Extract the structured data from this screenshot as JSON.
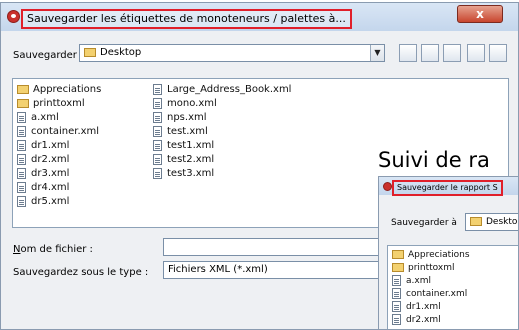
{
  "dialog": {
    "title": "Sauvegarder les étiquettes de monoteneurs / palettes à...",
    "close_label": "x",
    "save_in_label": "Sauvegarder à",
    "save_in_value": "Desktop",
    "files_col1": [
      "Appreciations",
      "printtoxml",
      "a.xml",
      "container.xml",
      "dr1.xml",
      "dr2.xml",
      "dr3.xml",
      "dr4.xml",
      "dr5.xml"
    ],
    "files_col2": [
      "Large_Address_Book.xml",
      "mono.xml",
      "nps.xml",
      "test.xml",
      "test1.xml",
      "test2.xml",
      "test3.xml"
    ],
    "filename_label": "Nom de fichier :",
    "filename_value": "",
    "filetype_label": "Sauvegardez sous le type :",
    "filetype_value": "Fichiers XML (*.xml)"
  },
  "overlay": {
    "heading": "Suivi de ra"
  },
  "dialog2": {
    "title": "Sauvegarder le rapport S",
    "save_in_label": "Sauvegarder à",
    "save_in_value": "Deskto",
    "files": [
      "Appreciations",
      "printtoxml",
      "a.xml",
      "container.xml",
      "dr1.xml",
      "dr2.xml"
    ]
  }
}
